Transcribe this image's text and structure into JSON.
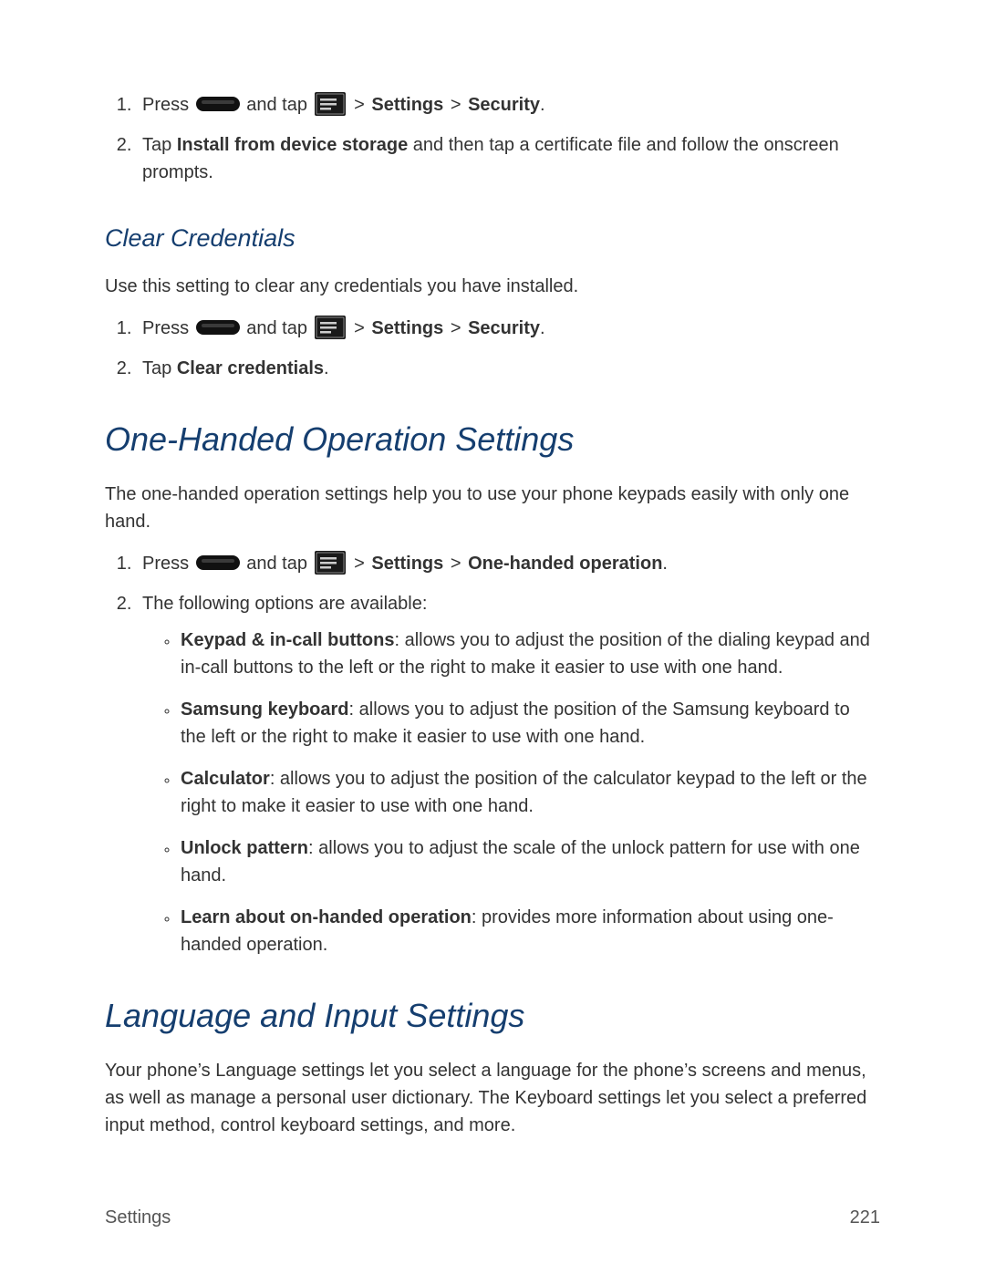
{
  "steps_install": {
    "step1": {
      "press": "Press",
      "and_tap": " and tap ",
      "gt1": " > ",
      "settings": "Settings",
      "gt2": " > ",
      "security": "Security",
      "period": "."
    },
    "step2": {
      "prefix": "Tap ",
      "bold": "Install from device storage",
      "rest": " and then tap a certificate file and follow the onscreen prompts."
    }
  },
  "clear_credentials": {
    "title": "Clear Credentials",
    "intro": "Use this setting to clear any credentials you have installed.",
    "step1": {
      "press": "Press",
      "and_tap": " and tap ",
      "gt1": " > ",
      "settings": "Settings",
      "gt2": " > ",
      "security": "Security",
      "period": "."
    },
    "step2": {
      "prefix": "Tap ",
      "bold": "Clear credentials",
      "period": "."
    }
  },
  "one_handed": {
    "title": "One-Handed Operation Settings",
    "intro": "The one-handed operation settings help you to use your phone keypads easily with only one hand.",
    "step1": {
      "press": "Press",
      "and_tap": " and tap ",
      "gt1": " > ",
      "settings": "Settings",
      "gt2": " > ",
      "target": "One-handed operation",
      "period": "."
    },
    "step2_text": "The following options are available:",
    "bullets": {
      "b1": {
        "bold": "Keypad & in-call buttons",
        "rest": ": allows you to adjust the position of the dialing keypad and in-call buttons to the left or the right to make it easier to use with one hand."
      },
      "b2": {
        "bold": "Samsung keyboard",
        "rest": ": allows you to adjust the position of the Samsung keyboard to the left or the right to make it easier to use with one hand."
      },
      "b3": {
        "bold": "Calculator",
        "rest": ": allows you to adjust the position of the calculator keypad to the left or the right to make it easier to use with one hand."
      },
      "b4": {
        "bold": "Unlock pattern",
        "rest": ": allows you to adjust the scale of the unlock pattern for use with one hand."
      },
      "b5": {
        "bold": "Learn about on-handed operation",
        "rest": ": provides more information about using one-handed operation."
      }
    }
  },
  "language_input": {
    "title": "Language and Input Settings",
    "intro": "Your phone’s Language settings let you select a language for the phone’s screens and menus, as well as manage a personal user dictionary. The Keyboard settings let you select a preferred input method, control keyboard settings, and more."
  },
  "footer": {
    "section": "Settings",
    "page": "221"
  }
}
